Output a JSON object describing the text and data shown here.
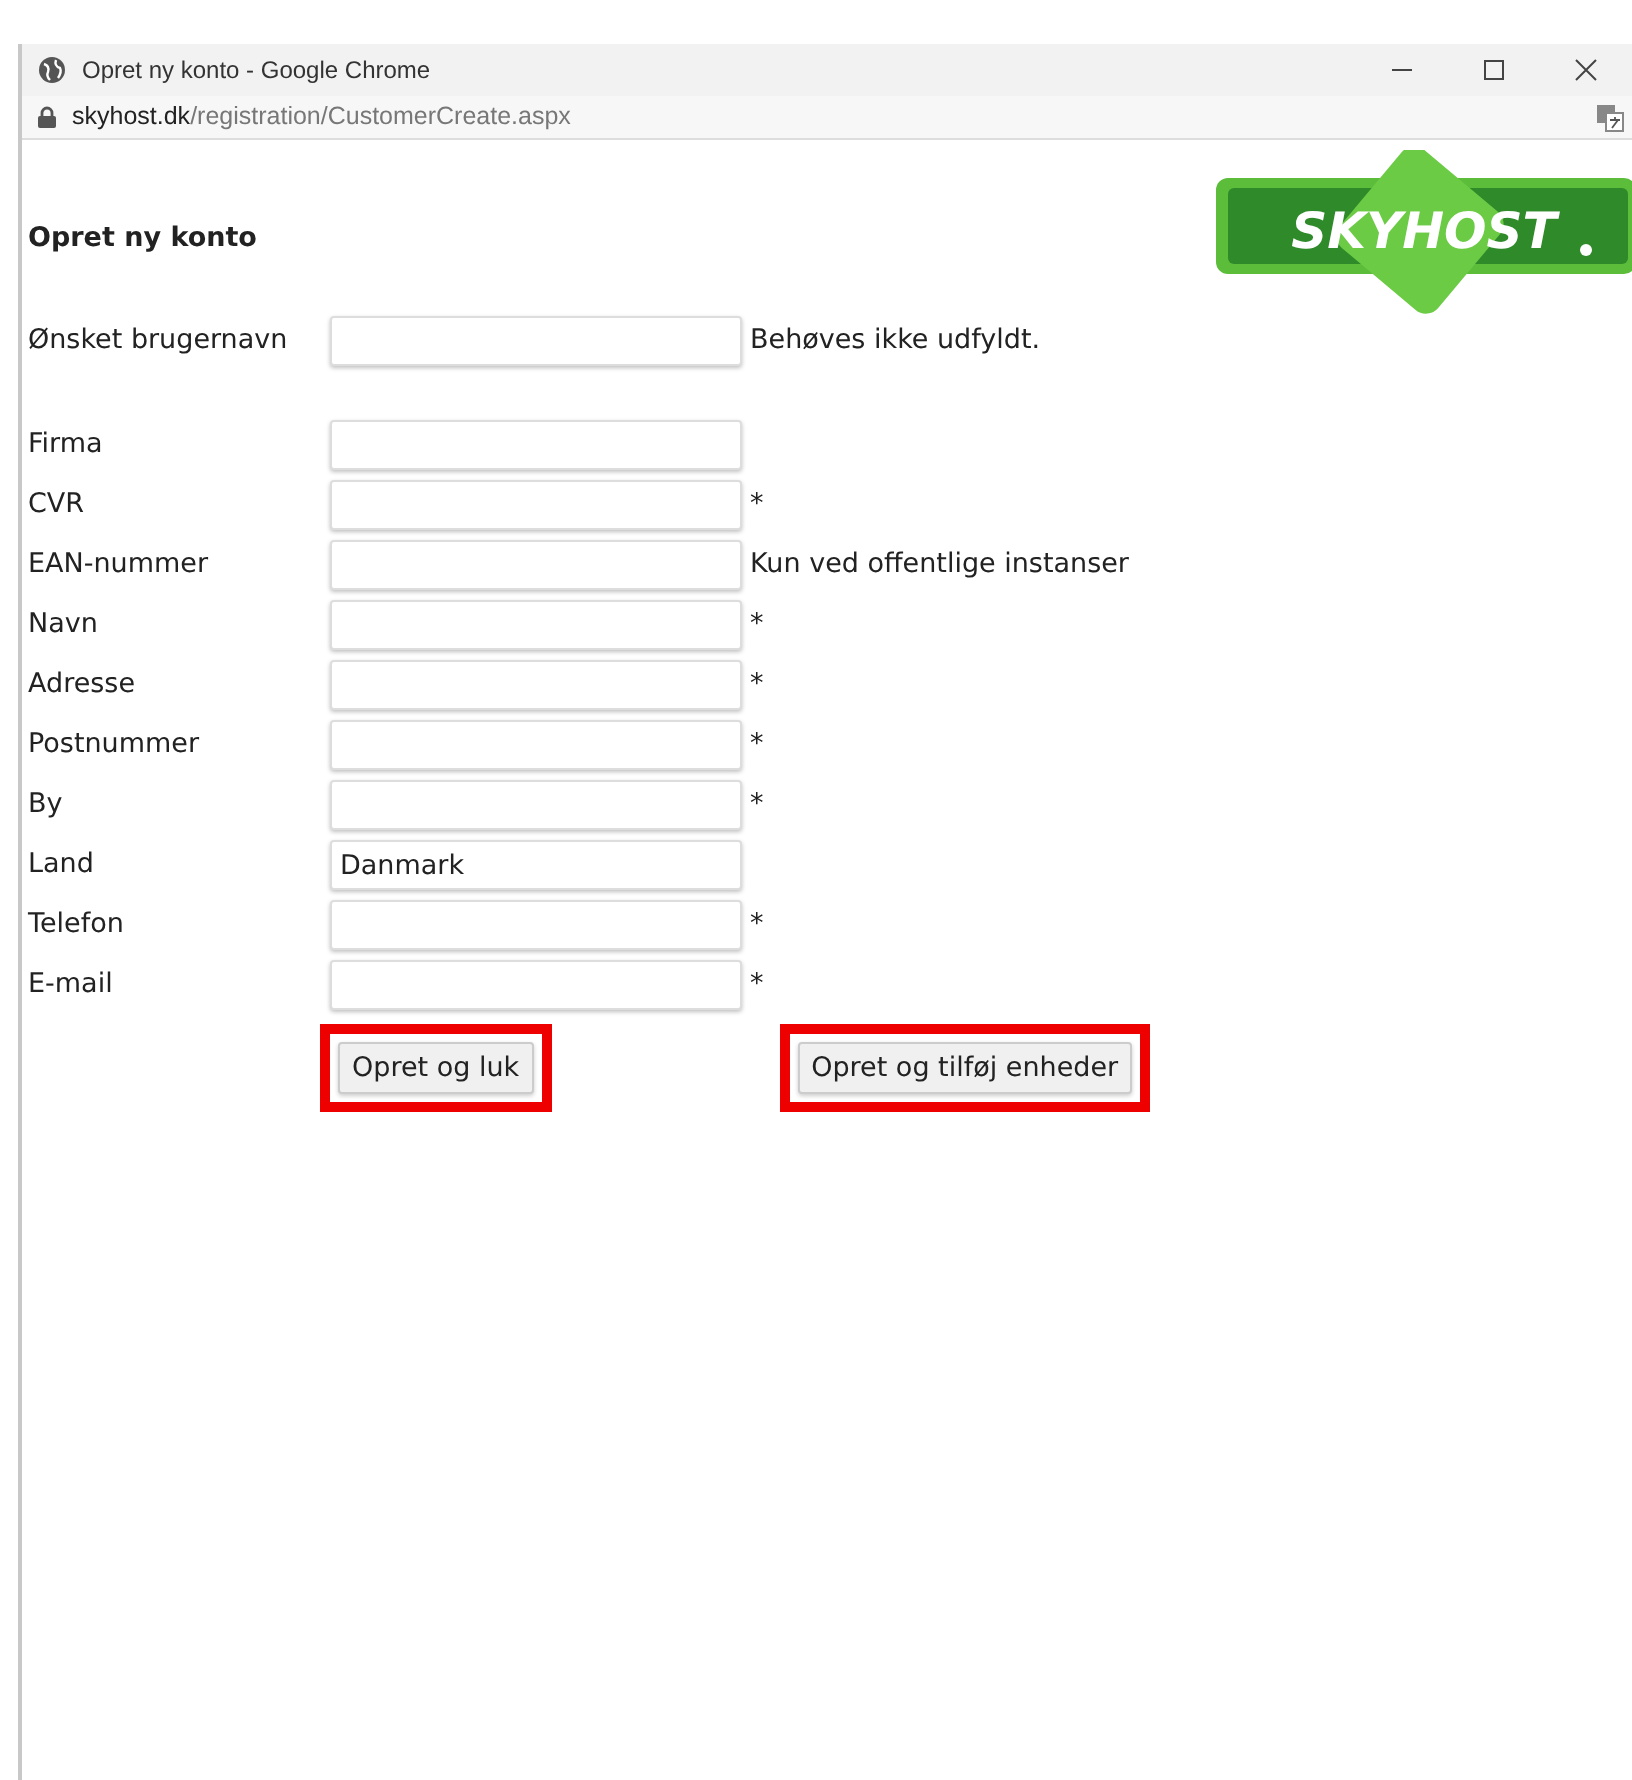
{
  "window": {
    "title": "Opret ny konto - Google Chrome"
  },
  "address_bar": {
    "domain": "skyhost.dk",
    "path": "/registration/CustomerCreate.aspx"
  },
  "page": {
    "heading": "Opret ny konto",
    "logo": "SKYHOST",
    "username": {
      "label": "Ønsket brugernavn",
      "note": "Behøves ikke udfyldt."
    },
    "fields": [
      {
        "label": "Firma"
      },
      {
        "label": "CVR",
        "note": "*"
      },
      {
        "label": "EAN-nummer",
        "note": "Kun ved offentlige instanser"
      },
      {
        "label": "Navn",
        "note": "*"
      },
      {
        "label": "Adresse",
        "note": "*"
      },
      {
        "label": "Postnummer",
        "note": "*"
      },
      {
        "label": "By",
        "note": "*"
      },
      {
        "label": "Land",
        "value": "Danmark"
      },
      {
        "label": "Telefon",
        "note": "*"
      },
      {
        "label": "E-mail",
        "note": "*"
      }
    ],
    "buttons": [
      {
        "label": "Opret og luk",
        "highlighted": true
      },
      {
        "label": "Opret og tilføj enheder",
        "highlighted": true
      }
    ]
  }
}
